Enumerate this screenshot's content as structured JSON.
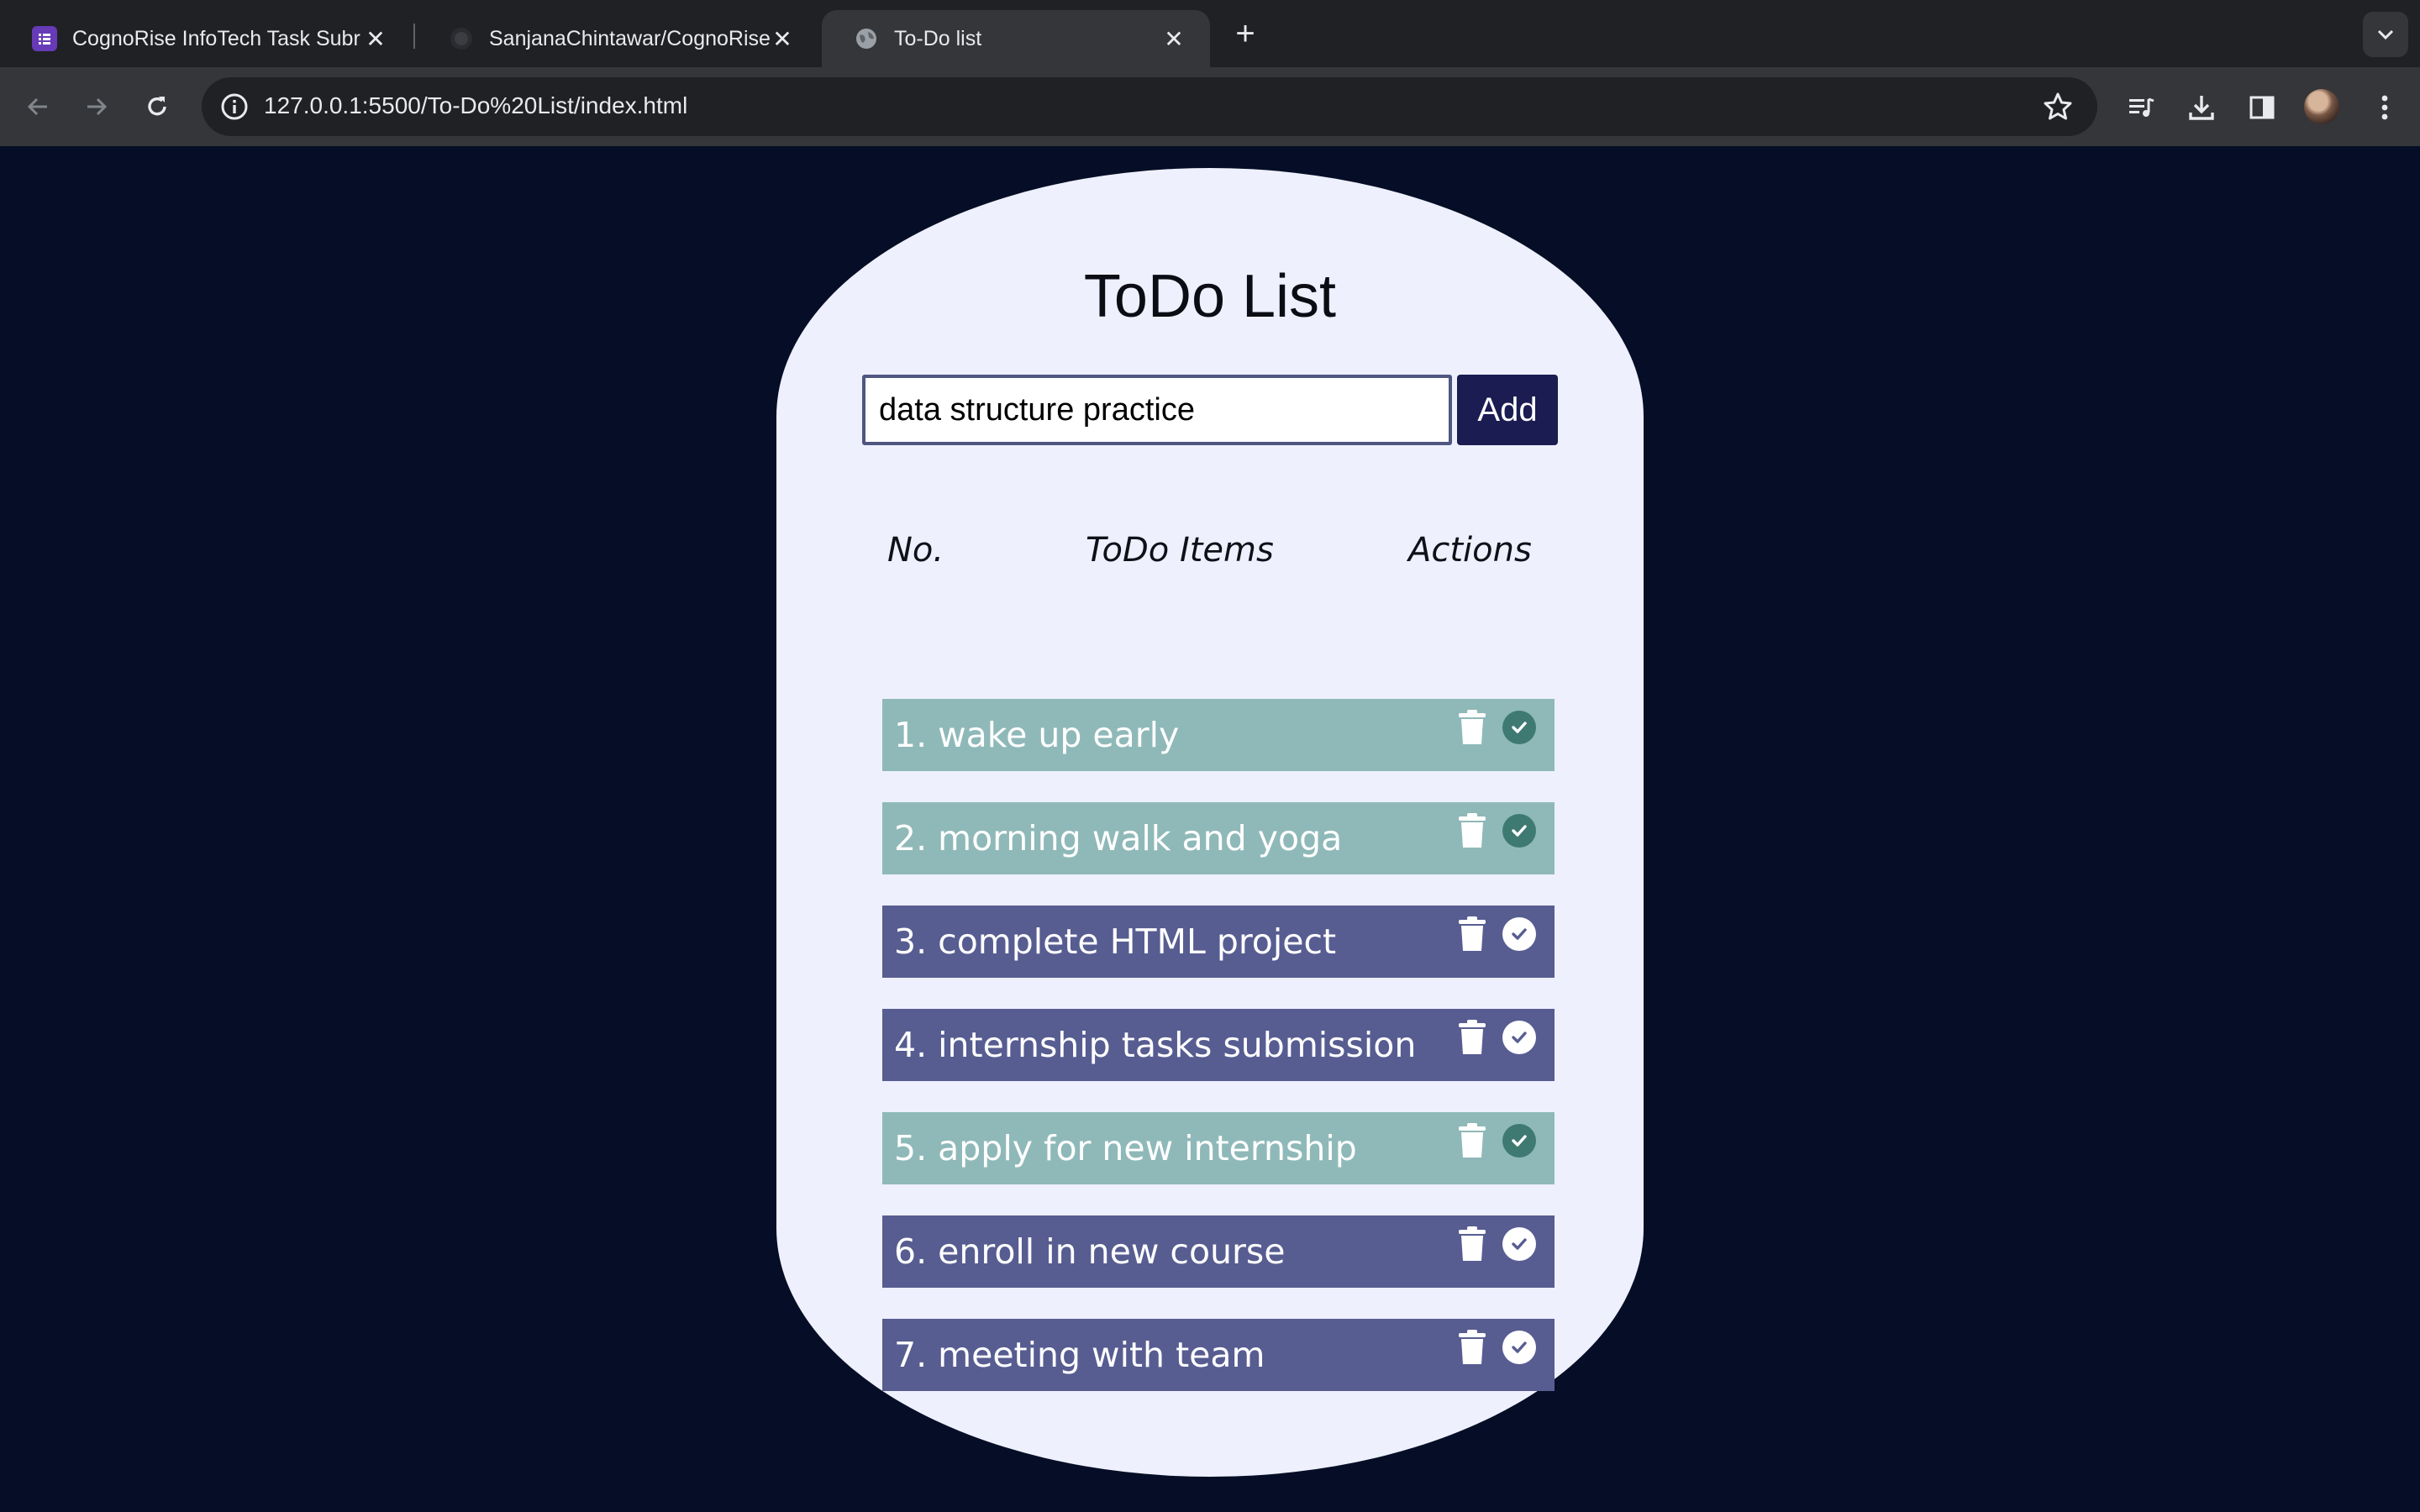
{
  "browser": {
    "tabs": [
      {
        "title": "CognoRise InfoTech Task Subr",
        "active": false,
        "favicon": "forms-icon"
      },
      {
        "title": "SanjanaChintawar/CognoRise",
        "active": false,
        "favicon": "github-icon"
      },
      {
        "title": "To-Do list",
        "active": true,
        "favicon": "globe-icon"
      }
    ],
    "url": "127.0.0.1:5500/To-Do%20List/index.html"
  },
  "app": {
    "title": "ToDo List",
    "input_value": "data structure practice",
    "add_label": "Add",
    "columns": {
      "no": "No.",
      "items": "ToDo Items",
      "actions": "Actions"
    },
    "items": [
      {
        "label": "1. wake up early",
        "completed": true
      },
      {
        "label": "2. morning walk and yoga",
        "completed": true
      },
      {
        "label": "3. complete HTML project",
        "completed": false
      },
      {
        "label": "4. internship tasks submission",
        "completed": false
      },
      {
        "label": "5. apply for new internship",
        "completed": true
      },
      {
        "label": "6. enroll in new course",
        "completed": false
      },
      {
        "label": "7. meeting with team",
        "completed": false
      }
    ]
  },
  "colors": {
    "page_bg": "#050e26",
    "card_bg": "#eef0fd",
    "completed_row": "#8fb9b8",
    "pending_row": "#575d91",
    "completed_check": "#3f7a72",
    "pending_check": "#ffffff",
    "add_button": "#1a1c52"
  }
}
